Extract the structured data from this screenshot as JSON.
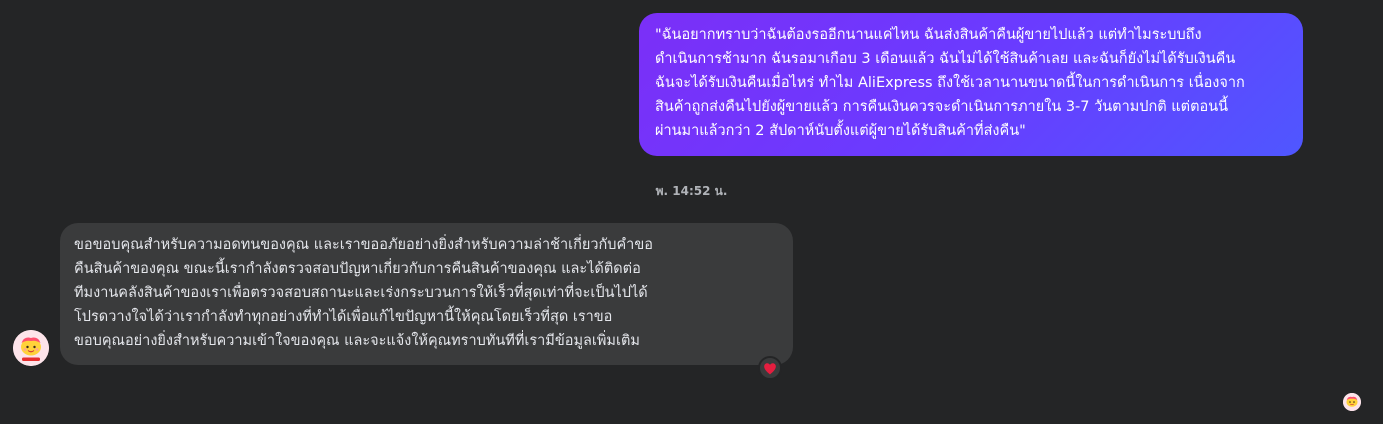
{
  "conversation": {
    "outgoing_message": "\"ฉันอยากทราบว่าฉันต้องรออีกนานแค่ไหน ฉันส่งสินค้าคืนผู้ขายไปแล้ว แต่ทำไมระบบถึง\nดำเนินการช้ามาก ฉันรอมาเกือบ 3 เดือนแล้ว ฉันไม่ได้ใช้สินค้าเลย และฉันก็ยังไม่ได้รับเงินคืน\nฉันจะได้รับเงินคืนเมื่อไหร่ ทำไม AliExpress ถึงใช้เวลานานขนาดนี้ในการดำเนินการ เนื่องจาก\nสินค้าถูกส่งคืนไปยังผู้ขายแล้ว การคืนเงินควรจะดำเนินการภายใน 3-7 วันตามปกติ แต่ตอนนี้\nผ่านมาแล้วกว่า 2 สัปดาห์นับตั้งแต่ผู้ขายได้รับสินค้าที่ส่งคืน\"",
    "timestamp": "พ. 14:52 น.",
    "incoming_message": "ขอขอบคุณสำหรับความอดทนของคุณ และเราขออภัยอย่างยิ่งสำหรับความล่าช้าเกี่ยวกับคำขอ\nคืนสินค้าของคุณ ขณะนี้เรากำลังตรวจสอบปัญหาเกี่ยวกับการคืนสินค้าของคุณ และได้ติดต่อ\nทีมงานคลังสินค้าของเราเพื่อตรวจสอบสถานะและเร่งกระบวนการให้เร็วที่สุดเท่าที่จะเป็นไปได้\nโปรดวางใจได้ว่าเรากำลังทำทุกอย่างที่ทำได้เพื่อแก้ไขปัญหานี้ให้คุณโดยเร็วที่สุด เราขอ\nขอบคุณอย่างยิ่งสำหรับความเข้าใจของคุณ และจะแจ้งให้คุณทราบทันทีที่เรามีข้อมูลเพิ่มเติม",
    "reaction": "heart",
    "avatar_icon": "aliexpress-mascot-icon",
    "colors": {
      "background": "#242526",
      "outgoing_bubble_start": "#7b2ff7",
      "outgoing_bubble_end": "#4f57ff",
      "incoming_bubble": "#3a3b3c",
      "text": "#e4e6eb",
      "timestamp": "#b0b3b8",
      "reaction": "#e41e3f"
    }
  }
}
